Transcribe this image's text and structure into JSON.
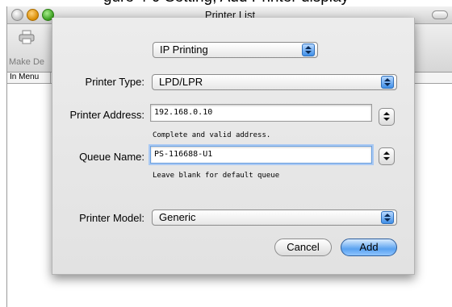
{
  "caption": "gure 4-9 Setting, Add Printer display",
  "window": {
    "title": "Printer List",
    "toolbar": {
      "make_default_label": "Make De"
    },
    "list_header": {
      "column1": "In Menu"
    }
  },
  "sheet": {
    "mode_popup": "IP Printing",
    "printer_type": {
      "label": "Printer Type:",
      "value": "LPD/LPR"
    },
    "printer_address": {
      "label": "Printer Address:",
      "value": "192.168.0.10",
      "hint": "Complete and valid address."
    },
    "queue_name": {
      "label": "Queue Name:",
      "value": "PS-116688-U1",
      "hint": "Leave blank for default queue"
    },
    "printer_model": {
      "label": "Printer Model:",
      "value": "Generic"
    },
    "buttons": {
      "cancel": "Cancel",
      "add": "Add"
    }
  },
  "colors": {
    "accent": "#5aa2f0",
    "focus_ring": "#a9c9f3"
  }
}
